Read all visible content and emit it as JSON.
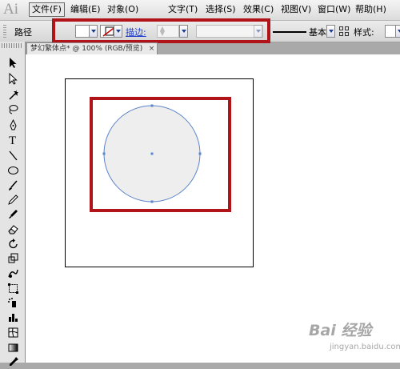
{
  "app": {
    "logo": "Ai"
  },
  "menu": [
    {
      "label": "文件(F)",
      "active": true
    },
    {
      "label": "编辑(E)"
    },
    {
      "label": "对象(O)"
    },
    {
      "label": "文字(T)"
    },
    {
      "label": "选择(S)"
    },
    {
      "label": "效果(C)"
    },
    {
      "label": "视图(V)"
    },
    {
      "label": "窗口(W)"
    },
    {
      "label": "帮助(H)"
    }
  ],
  "control_bar": {
    "object_type": "路径",
    "stroke_link": "描边:",
    "stroke_weight": "",
    "stroke_profile": "基本",
    "style_label": "样式:"
  },
  "document": {
    "tab_title": "梦幻繁体点* @ 100% (RGB/预览)",
    "close": "×"
  },
  "colors": {
    "highlight": "#b01318",
    "path": "#5a84c8",
    "circle_fill": "#eeeeee",
    "menu_bg": "#dcdcdc"
  },
  "tools": [
    "selection-icon",
    "direct-selection-icon",
    "magic-wand-icon",
    "lasso-icon",
    "pen-icon",
    "type-icon",
    "line-icon",
    "ellipse-icon",
    "paintbrush-icon",
    "pencil-icon",
    "blob-brush-icon",
    "eraser-icon",
    "rotate-icon",
    "scale-icon",
    "warp-icon",
    "free-transform-icon",
    "symbol-sprayer-icon",
    "graph-icon",
    "mesh-icon",
    "gradient-icon",
    "eyedropper-icon",
    "blend-icon"
  ],
  "watermark": {
    "main": "Bai 经验",
    "sub": "jingyan.baidu.com"
  }
}
